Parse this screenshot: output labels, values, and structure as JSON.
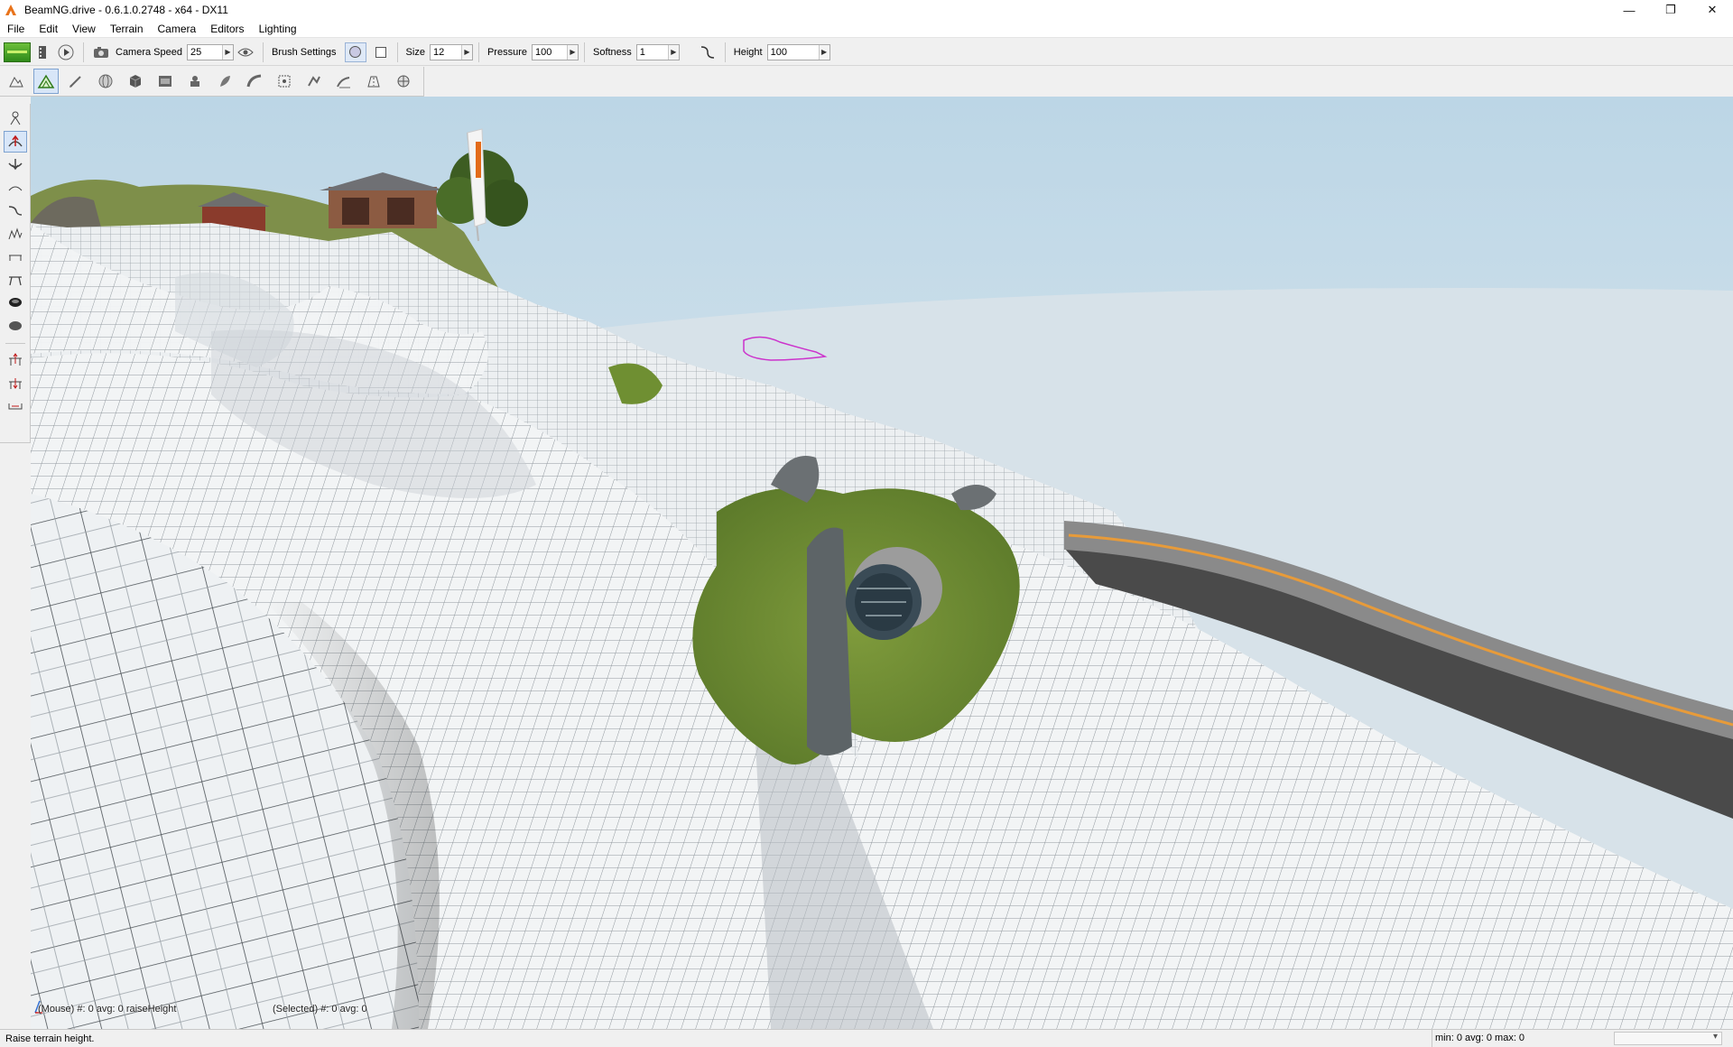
{
  "window": {
    "title": "BeamNG.drive - 0.6.1.0.2748 - x64 - DX11",
    "controls": {
      "minimize": "—",
      "restore": "❐",
      "close": "✕"
    }
  },
  "menu": [
    "File",
    "Edit",
    "View",
    "Terrain",
    "Camera",
    "Editors",
    "Lighting"
  ],
  "toolbar": {
    "camera_speed_label": "Camera Speed",
    "camera_speed_value": "25",
    "brush_settings_label": "Brush Settings",
    "size_label": "Size",
    "size_value": "12",
    "pressure_label": "Pressure",
    "pressure_value": "100",
    "softness_label": "Softness",
    "softness_value": "1",
    "height_label": "Height",
    "height_value": "100"
  },
  "viewport": {
    "mouse_readout": "(Mouse) #: 0  avg: 0 raiseHeight",
    "selected_readout": "(Selected) #: 0  avg: 0"
  },
  "status": {
    "message": "Raise terrain height.",
    "stats": "min: 0  avg: 0  max: 0"
  },
  "icons": {
    "toolbar1": [
      "world-editor-logo-icon",
      "film-icon",
      "play-icon",
      "camera-icon",
      "eye-icon",
      "softness-curve-icon"
    ],
    "toolbar2": [
      "terrain-overview-icon",
      "terrain-editor-icon",
      "terrain-painter-icon",
      "sphere-icon",
      "cube-icon",
      "material-icon",
      "spawn-icon",
      "forest-icon",
      "road-icon",
      "mesh-road-icon",
      "river-icon",
      "decal-icon",
      "decal-road-icon",
      "sun-icon"
    ],
    "palette": [
      "select-icon",
      "raise-height-icon",
      "lower-height-icon",
      "smooth-icon",
      "slope-icon",
      "noise-icon",
      "flatten-icon",
      "set-height-icon",
      "fill-empty-icon",
      "clear-icon",
      "add-terrain-icon",
      "remove-terrain-icon",
      "paint-mask-icon"
    ]
  },
  "colors": {
    "sky": "#d2e2ea",
    "terrain": "#f1f3f4",
    "grid": "#8f969c",
    "grass": "#6f8f32",
    "road": "#7f7f7f",
    "road_line": "#e79b3a",
    "selection": "#cc33cc"
  }
}
